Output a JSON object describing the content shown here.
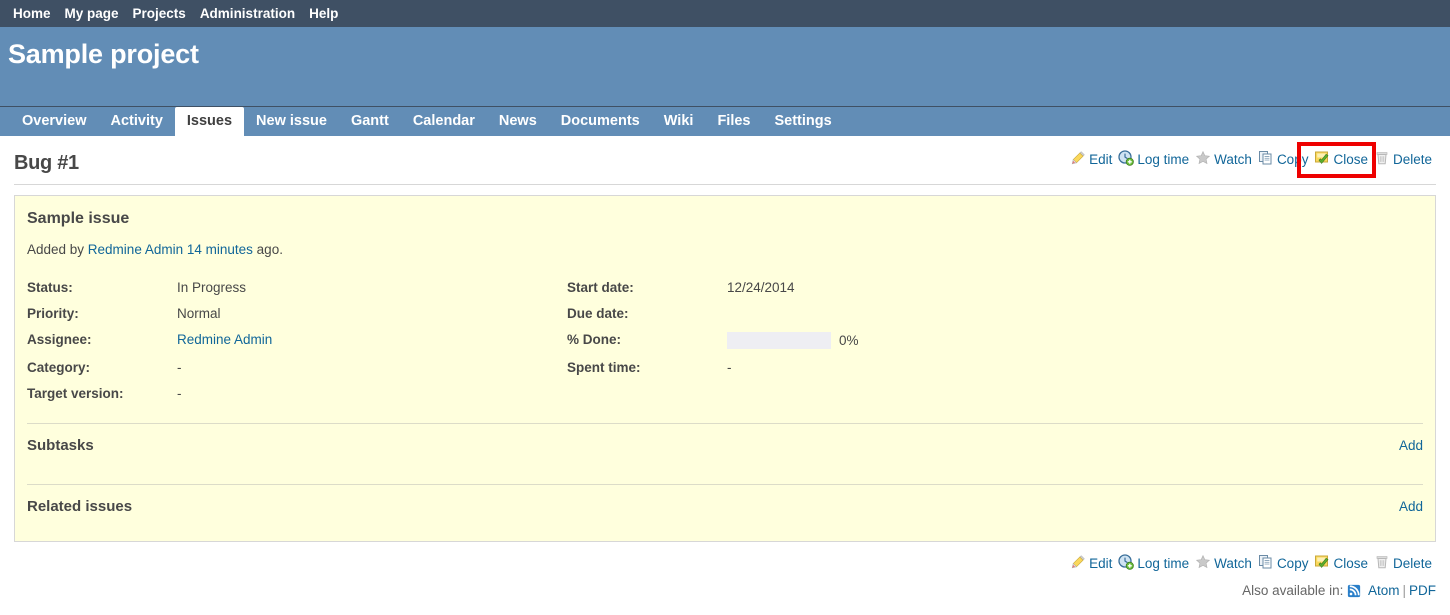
{
  "top_menu": {
    "items": [
      {
        "label": "Home",
        "name": "home"
      },
      {
        "label": "My page",
        "name": "my-page"
      },
      {
        "label": "Projects",
        "name": "projects"
      },
      {
        "label": "Administration",
        "name": "administration"
      },
      {
        "label": "Help",
        "name": "help"
      }
    ]
  },
  "header": {
    "project_title": "Sample project",
    "bg_color": "#628db6",
    "top_menu_color": "#3f5064"
  },
  "main_menu": {
    "tabs": [
      {
        "label": "Overview",
        "selected": false
      },
      {
        "label": "Activity",
        "selected": false
      },
      {
        "label": "Issues",
        "selected": true
      },
      {
        "label": "New issue",
        "selected": false
      },
      {
        "label": "Gantt",
        "selected": false
      },
      {
        "label": "Calendar",
        "selected": false
      },
      {
        "label": "News",
        "selected": false
      },
      {
        "label": "Documents",
        "selected": false
      },
      {
        "label": "Wiki",
        "selected": false
      },
      {
        "label": "Files",
        "selected": false
      },
      {
        "label": "Settings",
        "selected": false
      }
    ]
  },
  "issue": {
    "page_title": "Bug #1",
    "subject": "Sample issue",
    "added_by_prefix": "Added by ",
    "author": "Redmine Admin",
    "added_time": "14 minutes",
    "added_suffix": " ago.",
    "attributes": {
      "status_label": "Status:",
      "status_value": "In Progress",
      "priority_label": "Priority:",
      "priority_value": "Normal",
      "assignee_label": "Assignee:",
      "assignee_value": "Redmine Admin",
      "category_label": "Category:",
      "category_value": "-",
      "target_version_label": "Target version:",
      "target_version_value": "-",
      "start_date_label": "Start date:",
      "start_date_value": "12/24/2014",
      "due_date_label": "Due date:",
      "due_date_value": "",
      "done_label": "% Done:",
      "done_value": "0%",
      "done_percent": 0,
      "spent_time_label": "Spent time:",
      "spent_time_value": "-"
    },
    "subtasks": {
      "title": "Subtasks",
      "add_label": "Add"
    },
    "related_issues": {
      "title": "Related issues",
      "add_label": "Add"
    }
  },
  "toolbar": {
    "edit": "Edit",
    "log_time": "Log time",
    "watch": "Watch",
    "copy": "Copy",
    "close": "Close",
    "delete": "Delete",
    "highlight_color": "#ee0000",
    "highlighted_action": "Close"
  },
  "footer": {
    "also_available_in": "Also available in:",
    "atom": "Atom",
    "separator": "|",
    "pdf": "PDF"
  }
}
